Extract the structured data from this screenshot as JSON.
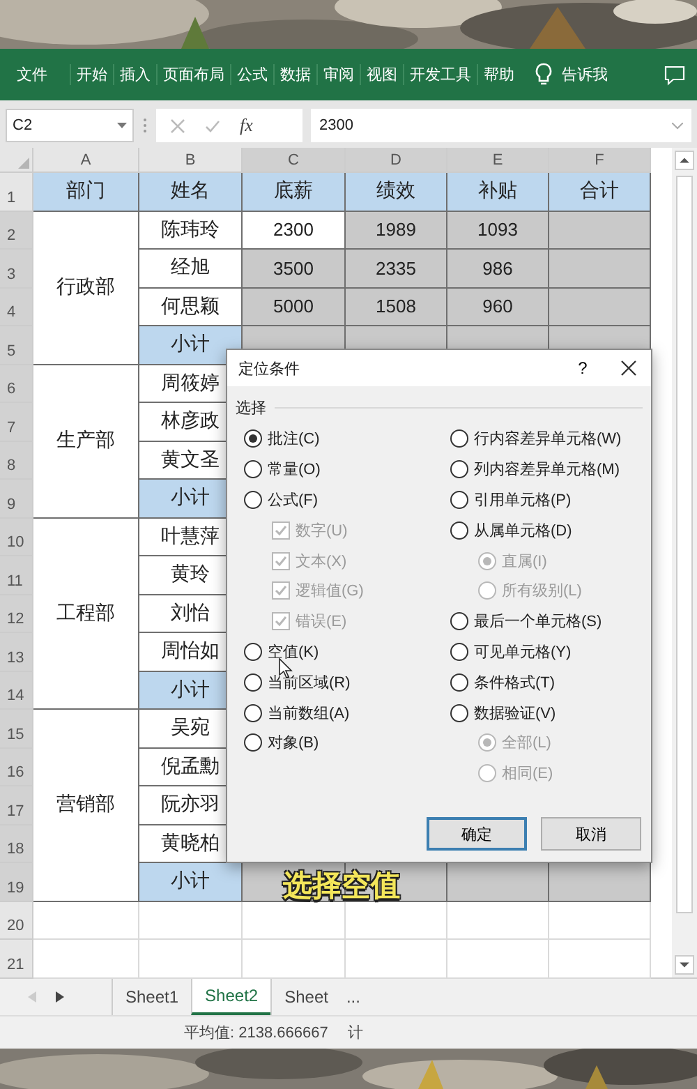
{
  "ribbon": {
    "tabs": [
      "文件",
      "开始",
      "插入",
      "页面布局",
      "公式",
      "数据",
      "审阅",
      "视图",
      "开发工具",
      "帮助"
    ],
    "tell_me": "告诉我"
  },
  "formula_bar": {
    "name_box": "C2",
    "fx_label": "fx",
    "value": "2300"
  },
  "sheet": {
    "column_headers": [
      {
        "label": "A",
        "selected": false
      },
      {
        "label": "B",
        "selected": false
      },
      {
        "label": "C",
        "selected": true
      },
      {
        "label": "D",
        "selected": true
      },
      {
        "label": "E",
        "selected": true
      },
      {
        "label": "F",
        "selected": true
      }
    ],
    "row_numbers": [
      {
        "label": "1",
        "selected": false
      },
      {
        "label": "2",
        "selected": true
      },
      {
        "label": "3",
        "selected": true
      },
      {
        "label": "4",
        "selected": true
      },
      {
        "label": "5",
        "selected": true
      },
      {
        "label": "6",
        "selected": true
      },
      {
        "label": "7",
        "selected": true
      },
      {
        "label": "8",
        "selected": true
      },
      {
        "label": "9",
        "selected": true
      },
      {
        "label": "10",
        "selected": true
      },
      {
        "label": "11",
        "selected": true
      },
      {
        "label": "12",
        "selected": true
      },
      {
        "label": "13",
        "selected": true
      },
      {
        "label": "14",
        "selected": true
      },
      {
        "label": "15",
        "selected": true
      },
      {
        "label": "16",
        "selected": true
      },
      {
        "label": "17",
        "selected": true
      },
      {
        "label": "18",
        "selected": true
      },
      {
        "label": "19",
        "selected": true
      },
      {
        "label": "20",
        "selected": false
      },
      {
        "label": "21",
        "selected": false
      }
    ],
    "header_row": [
      "部门",
      "姓名",
      "底薪",
      "绩效",
      "补贴",
      "合计"
    ],
    "departments": [
      {
        "name": "行政部",
        "rows": [
          {
            "kind": "person",
            "name": "陈玮玲",
            "cells": [
              {
                "text": "2300",
                "selected": false
              },
              {
                "text": "1989",
                "selected": true
              },
              {
                "text": "1093",
                "selected": true
              },
              {
                "selected": true
              }
            ]
          },
          {
            "kind": "person",
            "name": "经旭",
            "cells": [
              {
                "text": "3500",
                "selected": true
              },
              {
                "text": "2335",
                "selected": true
              },
              {
                "text": "986",
                "selected": true
              },
              {
                "selected": true
              }
            ]
          },
          {
            "kind": "person",
            "name": "何思颖",
            "cells": [
              {
                "text": "5000",
                "selected": true
              },
              {
                "text": "1508",
                "selected": true
              },
              {
                "text": "960",
                "selected": true
              },
              {
                "selected": true
              }
            ]
          },
          {
            "kind": "subtotal",
            "name": "小计",
            "cells": [
              {
                "selected": true
              },
              {
                "selected": true
              },
              {
                "selected": true
              },
              {
                "selected": true
              }
            ]
          }
        ]
      },
      {
        "name": "生产部",
        "rows": [
          {
            "kind": "person",
            "name": "周筱婷"
          },
          {
            "kind": "person",
            "name": "林彦政"
          },
          {
            "kind": "person",
            "name": "黄文圣"
          },
          {
            "kind": "subtotal",
            "name": "小计"
          }
        ]
      },
      {
        "name": "工程部",
        "rows": [
          {
            "kind": "person",
            "name": "叶慧萍"
          },
          {
            "kind": "person",
            "name": "黄玲"
          },
          {
            "kind": "person",
            "name": "刘怡"
          },
          {
            "kind": "person",
            "name": "周怡如"
          },
          {
            "kind": "subtotal",
            "name": "小计"
          }
        ]
      },
      {
        "name": "营销部",
        "rows": [
          {
            "kind": "person",
            "name": "吴宛"
          },
          {
            "kind": "person",
            "name": "倪孟勳"
          },
          {
            "kind": "person",
            "name": "阮亦羽"
          },
          {
            "kind": "person",
            "name": "黄晓柏"
          },
          {
            "kind": "subtotal",
            "name": "小计",
            "cells": [
              {
                "selected": true
              },
              {
                "selected": true
              },
              {
                "selected": true
              },
              {
                "selected": true
              }
            ]
          }
        ]
      }
    ]
  },
  "dialog": {
    "title": "定位条件",
    "help": "?",
    "group": "选择",
    "left": [
      {
        "kind": "radio",
        "label": "批注(C)",
        "checked": true,
        "disabled": false
      },
      {
        "kind": "radio",
        "label": "常量(O)",
        "checked": false,
        "disabled": false
      },
      {
        "kind": "radio",
        "label": "公式(F)",
        "checked": false,
        "disabled": false,
        "children": [
          {
            "kind": "checkbox",
            "label": "数字(U)",
            "checked": true,
            "disabled": true
          },
          {
            "kind": "checkbox",
            "label": "文本(X)",
            "checked": true,
            "disabled": true
          },
          {
            "kind": "checkbox",
            "label": "逻辑值(G)",
            "checked": true,
            "disabled": true
          },
          {
            "kind": "checkbox",
            "label": "错误(E)",
            "checked": true,
            "disabled": true
          }
        ]
      },
      {
        "kind": "radio",
        "label": "空值(K)",
        "checked": false,
        "disabled": false
      },
      {
        "kind": "radio",
        "label": "当前区域(R)",
        "checked": false,
        "disabled": false
      },
      {
        "kind": "radio",
        "label": "当前数组(A)",
        "checked": false,
        "disabled": false
      },
      {
        "kind": "radio",
        "label": "对象(B)",
        "checked": false,
        "disabled": false
      }
    ],
    "right": [
      {
        "kind": "radio",
        "label": "行内容差异单元格(W)",
        "checked": false,
        "disabled": false
      },
      {
        "kind": "radio",
        "label": "列内容差异单元格(M)",
        "checked": false,
        "disabled": false
      },
      {
        "kind": "radio",
        "label": "引用单元格(P)",
        "checked": false,
        "disabled": false
      },
      {
        "kind": "radio",
        "label": "从属单元格(D)",
        "checked": false,
        "disabled": false,
        "children": [
          {
            "kind": "radio",
            "label": "直属(I)",
            "checked": true,
            "disabled": true
          },
          {
            "kind": "radio",
            "label": "所有级别(L)",
            "checked": false,
            "disabled": true
          }
        ]
      },
      {
        "kind": "radio",
        "label": "最后一个单元格(S)",
        "checked": false,
        "disabled": false
      },
      {
        "kind": "radio",
        "label": "可见单元格(Y)",
        "checked": false,
        "disabled": false
      },
      {
        "kind": "radio",
        "label": "条件格式(T)",
        "checked": false,
        "disabled": false
      },
      {
        "kind": "radio",
        "label": "数据验证(V)",
        "checked": false,
        "disabled": false,
        "children": [
          {
            "kind": "radio",
            "label": "全部(L)",
            "checked": true,
            "disabled": true
          },
          {
            "kind": "radio",
            "label": "相同(E)",
            "checked": false,
            "disabled": true
          }
        ]
      }
    ],
    "buttons": [
      {
        "label": "确定",
        "default": true
      },
      {
        "label": "取消",
        "default": false
      }
    ]
  },
  "caption": "选择空值",
  "sheet_tabs": {
    "tabs": [
      {
        "label": "Sheet1",
        "selected": false
      },
      {
        "label": "Sheet2",
        "selected": true
      },
      {
        "label": "Sheet",
        "selected": false
      }
    ],
    "more": "..."
  },
  "status_bar": {
    "average": "平均值: 2138.666667",
    "count": "计"
  }
}
